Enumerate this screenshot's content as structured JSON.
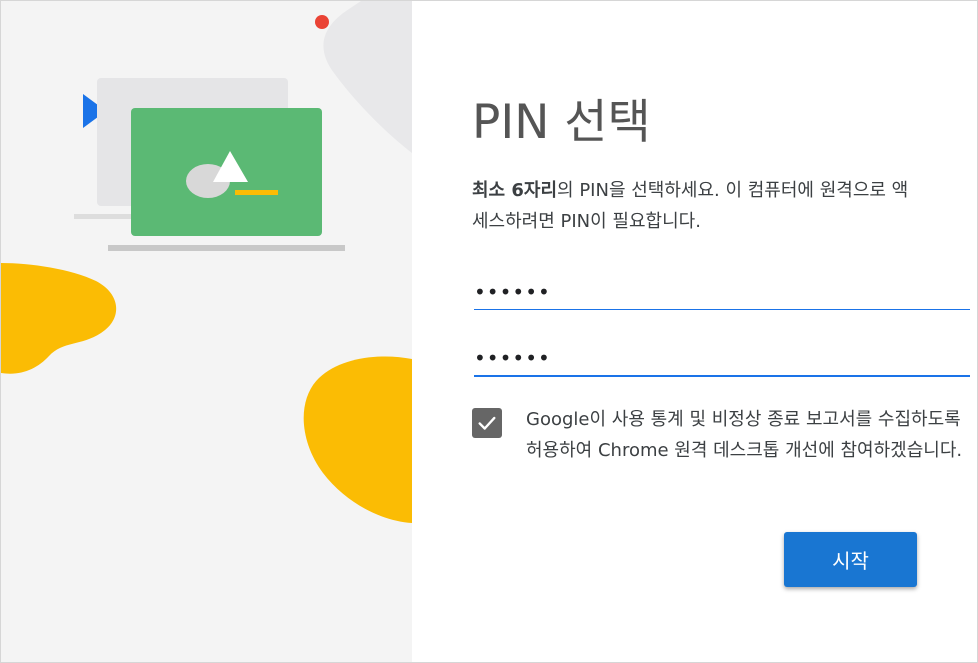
{
  "dialog": {
    "title": "PIN 선택",
    "description_bold": "최소 6자리",
    "description_rest": "의 PIN을 선택하세요. 이 컴퓨터에 원격으로 액세스하려면 PIN이 필요합니다.",
    "pin": {
      "value": "••••••"
    },
    "pin_confirm": {
      "value": "••••••"
    },
    "consent": {
      "checked": true,
      "label": "Google이 사용 통계 및 비정상 종료 보고서를 수집하도록 허용하여 Chrome 원격 데스크톱 개선에 참여하겠습니다."
    },
    "start_button": "시작"
  },
  "colors": {
    "accent": "#1976d2",
    "underline": "#1a73e8",
    "checkbox": "#666666",
    "laptop_screen": "#5bb974",
    "blob_yellow": "#fbbc04",
    "dot_red": "#ea4335",
    "play_blue": "#1a73e8"
  },
  "icons": {
    "checkbox_mark": "check-icon",
    "illustration": "remote-desktop-illustration"
  }
}
